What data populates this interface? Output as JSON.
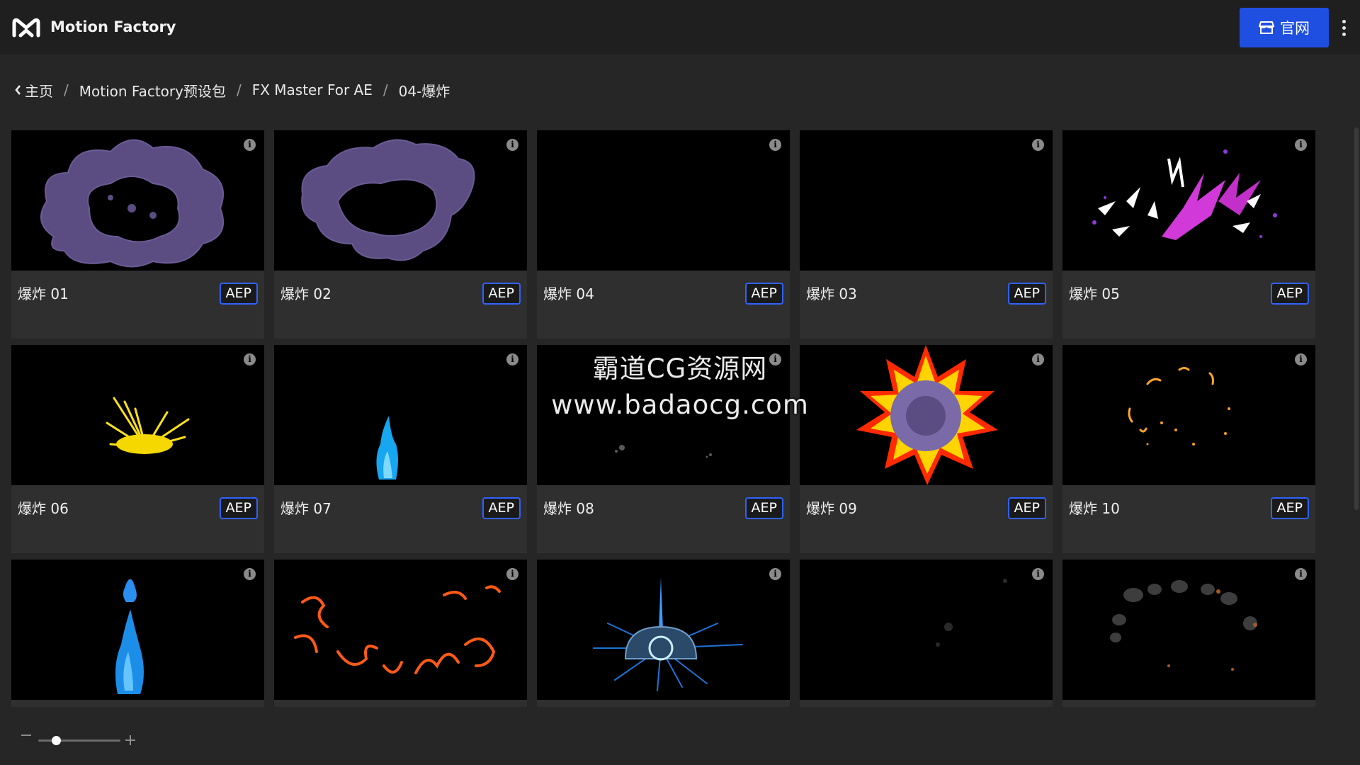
{
  "header": {
    "app_title": "Motion Factory",
    "site_button_label": "官网"
  },
  "breadcrumb": {
    "home": "主页",
    "separator": "/",
    "level1": "Motion Factory预设包",
    "level2": "FX Master For AE",
    "current": "04-爆炸"
  },
  "items": [
    {
      "title": "爆炸 01",
      "badge": "AEP",
      "thumb": "purple-smoke-ring"
    },
    {
      "title": "爆炸 02",
      "badge": "AEP",
      "thumb": "purple-smoke-cloud"
    },
    {
      "title": "爆炸 04",
      "badge": "AEP",
      "thumb": "empty"
    },
    {
      "title": "爆炸 03",
      "badge": "AEP",
      "thumb": "empty"
    },
    {
      "title": "爆炸 05",
      "badge": "AEP",
      "thumb": "magenta-shards"
    },
    {
      "title": "爆炸 06",
      "badge": "AEP",
      "thumb": "yellow-burst"
    },
    {
      "title": "爆炸 07",
      "badge": "AEP",
      "thumb": "blue-flame"
    },
    {
      "title": "爆炸 08",
      "badge": "AEP",
      "thumb": "dark-specks"
    },
    {
      "title": "爆炸 09",
      "badge": "AEP",
      "thumb": "fire-star"
    },
    {
      "title": "爆炸 10",
      "badge": "AEP",
      "thumb": "orange-sparks"
    },
    {
      "title": "",
      "badge": "",
      "thumb": "tall-blue-flame"
    },
    {
      "title": "",
      "badge": "",
      "thumb": "orange-tendrils"
    },
    {
      "title": "",
      "badge": "",
      "thumb": "blue-dome"
    },
    {
      "title": "",
      "badge": "",
      "thumb": "faint-smoke"
    },
    {
      "title": "",
      "badge": "",
      "thumb": "grey-debris"
    }
  ],
  "watermark": {
    "line1": "霸道CG资源网",
    "line2": "www.badaocg.com"
  },
  "colors": {
    "accent": "#1f4fe0",
    "badge_border": "#2f62ff",
    "background": "#262626",
    "card": "#2f2f2f"
  }
}
